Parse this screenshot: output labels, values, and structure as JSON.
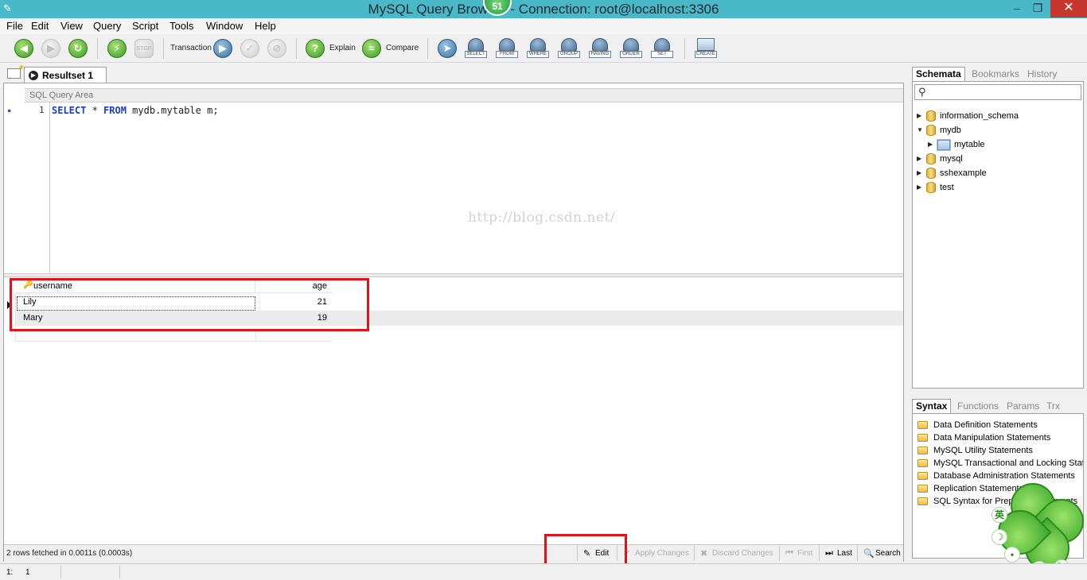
{
  "window": {
    "title": "MySQL Query Browser - Connection: root@localhost:3306",
    "badge": "51",
    "minimize_glyph": "–",
    "restore_glyph": "❐",
    "close_glyph": "✕"
  },
  "menu": [
    "File",
    "Edit",
    "View",
    "Query",
    "Script",
    "Tools",
    "Window",
    "Help"
  ],
  "toolbar": {
    "transaction_label": "Transaction",
    "explain_label": "Explain",
    "compare_label": "Compare",
    "clause_buttons": [
      "SELECT",
      "FROM",
      "WHERE",
      "GROUP",
      "HAVING",
      "ORDER",
      "SET"
    ],
    "create_label": "CREATE",
    "stop_label": "STOP"
  },
  "tabs": {
    "resultset_label": "Resultset 1"
  },
  "editor": {
    "header": "SQL Query Area",
    "line_number": "1",
    "sql_tokens": [
      {
        "text": "SELECT",
        "kind": "kw"
      },
      {
        "text": " * ",
        "kind": "plain"
      },
      {
        "text": "FROM",
        "kind": "kw"
      },
      {
        "text": " mydb.mytable m;",
        "kind": "plain"
      }
    ]
  },
  "grid": {
    "columns": [
      "username",
      "age"
    ],
    "rows": [
      {
        "username": "Lily",
        "age": "21"
      },
      {
        "username": "Mary",
        "age": "19"
      }
    ]
  },
  "watermark": "http://blog.csdn.net/",
  "result_bar": {
    "status": "2 rows fetched in 0.0011s (0.0003s)",
    "edit_label": "Edit",
    "apply_label": "Apply Changes",
    "discard_label": "Discard Changes",
    "first_label": "First",
    "last_label": "Last",
    "search_label": "Search"
  },
  "schemata_tabs": [
    "Schemata",
    "Bookmarks",
    "History"
  ],
  "schemata_tree": [
    {
      "label": "information_schema",
      "type": "db",
      "expanded": false
    },
    {
      "label": "mydb",
      "type": "db",
      "expanded": true
    },
    {
      "label": "mytable",
      "type": "table"
    },
    {
      "label": "mysql",
      "type": "db",
      "expanded": false
    },
    {
      "label": "sshexample",
      "type": "db",
      "expanded": false
    },
    {
      "label": "test",
      "type": "db",
      "expanded": false
    }
  ],
  "syntax_tabs": [
    "Syntax",
    "Functions",
    "Params",
    "Trx"
  ],
  "syntax_items": [
    "Data Definition Statements",
    "Data Manipulation Statements",
    "MySQL Utility Statements",
    "MySQL Transactional and Locking Statements",
    "Database Administration Statements",
    "Replication Statements",
    "SQL Syntax for Prepared Statements"
  ],
  "ime": {
    "lang": "英",
    "moon": "☽",
    "dot": "•"
  },
  "statusbar": {
    "line": "1:",
    "col": "1"
  },
  "colors": {
    "titlebar": "#49b8c7",
    "close": "#c7372f",
    "highlight": "#e0121a",
    "keyword": "#1a3bd6"
  }
}
